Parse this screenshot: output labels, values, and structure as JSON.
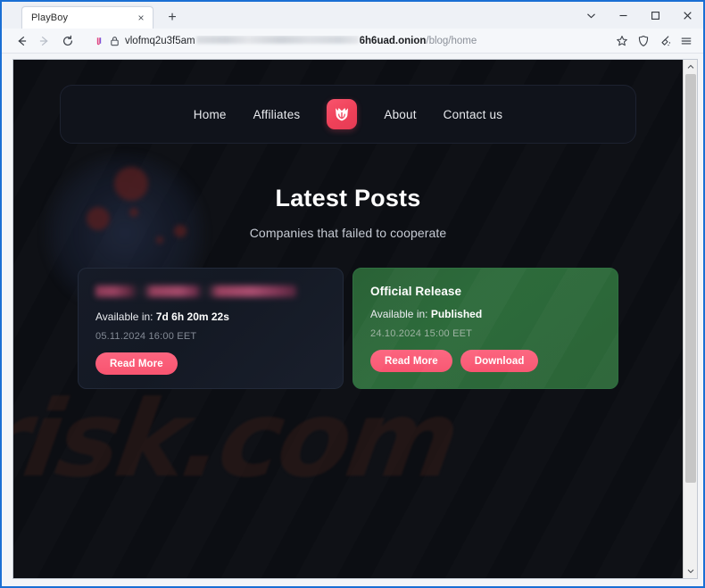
{
  "browser": {
    "tab": {
      "title": "PlayBoy",
      "close_label": "×"
    },
    "newtab_label": "+",
    "window_controls": {
      "list_label": "⌄",
      "minimize_label": "–",
      "maximize_label": "□",
      "close_label": "✕"
    },
    "nav": {
      "back_label": "←",
      "forward_label": "→",
      "reload_label": "↻"
    },
    "url": {
      "prefix": "vlofmq2u3f5am",
      "redacted": true,
      "host": "6h6uad.onion",
      "path": "/blog/home"
    },
    "toolbar_icons": [
      "bookmark-star-icon",
      "shield-icon",
      "new-identity-broom-icon",
      "hamburger-menu-icon"
    ]
  },
  "site": {
    "nav": {
      "links_left": [
        {
          "label": "Home"
        },
        {
          "label": "Affiliates"
        }
      ],
      "logo_name": "playboy-shield-logo",
      "links_right": [
        {
          "label": "About"
        },
        {
          "label": "Contact us"
        }
      ]
    },
    "hero": {
      "title": "Latest Posts",
      "subtitle": "Companies that failed to cooperate"
    },
    "cards": [
      {
        "variant": "dark",
        "title": "",
        "title_redacted": true,
        "available_label": "Available in:",
        "available_value": "7d 6h 20m 22s",
        "date": "05.11.2024 16:00 EET",
        "buttons": [
          {
            "label": "Read More"
          }
        ]
      },
      {
        "variant": "green",
        "title": "Official Release",
        "title_redacted": false,
        "available_label": "Available in:",
        "available_value": "Published",
        "date": "24.10.2024 15:00 EET",
        "buttons": [
          {
            "label": "Read More"
          },
          {
            "label": "Download"
          }
        ]
      }
    ],
    "watermark": "risk.com",
    "colors": {
      "accent_pink": "#f85470",
      "card_green": "#2d6b3b",
      "page_bg": "#0c0e13",
      "nav_bg": "#10131b"
    }
  }
}
